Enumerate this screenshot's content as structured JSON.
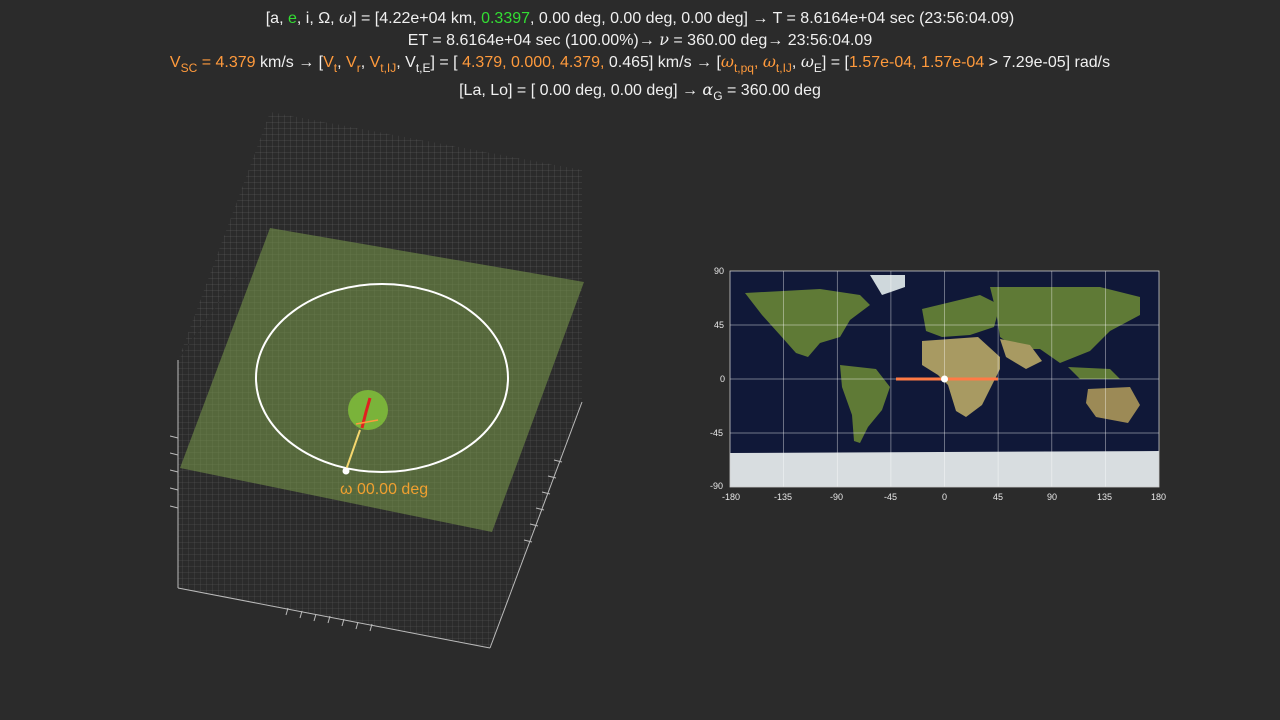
{
  "header": {
    "line1": {
      "lhs_a": "[a, ",
      "lhs_e": "e",
      "lhs_rest": ", i, Ω, ",
      "lhs_omega": "ω",
      "eq": "] = [4.22e+04 km, ",
      "e_value": "0.3397",
      "rest": ",   0.00 deg,   0.00 deg,   0.00 deg] → T = 8.6164e+04 sec (23:56:04.09)"
    },
    "line2": {
      "text_a": "ET = 8.6164e+04 sec (100.00%)→ ",
      "nu": "ν",
      "text_b": " = 360.00 deg→ 23:56:04.09"
    },
    "line3": {
      "vsc_label": "V",
      "vsc_sub": "SC",
      "vsc_value": " = 4.379",
      "vsc_unit": " km/s → [",
      "vt": "V",
      "vt_sub": "t",
      "vr": "V",
      "vr_sub": "r",
      "vtij": "V",
      "vtij_sub": "t,IJ",
      "vte": "V",
      "vte_sub": "t,E",
      "veq": "] = [ ",
      "v_vals": "4.379,  0.000,  4.379,",
      "v_last": "  0.465] km/s → [",
      "w1": "ω",
      "w1_sub": "t,pq",
      "w2": "ω",
      "w2_sub": "t,IJ",
      "w3": "ω",
      "w3_sub": "E",
      "weq": "] = [",
      "w_vals": "1.57e-04, 1.57e-04",
      "w_last": " > 7.29e-05] rad/s"
    },
    "line4": {
      "text_a": "[La, Lo] = [  0.00 deg,   0.00 deg] → ",
      "alpha": "α",
      "alpha_sub": "G",
      "text_b": " = 360.00 deg"
    }
  },
  "orbit_plot": {
    "annotation": "ω 00.00 deg"
  },
  "map": {
    "yticks": [
      "90",
      "45",
      "0",
      "-45",
      "-90"
    ],
    "xticks": [
      "-180",
      "-135",
      "-90",
      "-45",
      "0",
      "45",
      "90",
      "135",
      "180"
    ],
    "track_color": "#ff7a45",
    "spacecraft_lat": 0,
    "spacecraft_lon": 0
  },
  "colors": {
    "background": "#2b2b2b",
    "orbit": "#ffffff",
    "plane": "#7a9a4a",
    "earth": "#7ab33a",
    "highlight_green": "#33dd33",
    "highlight_orange": "#ff9a3c"
  }
}
